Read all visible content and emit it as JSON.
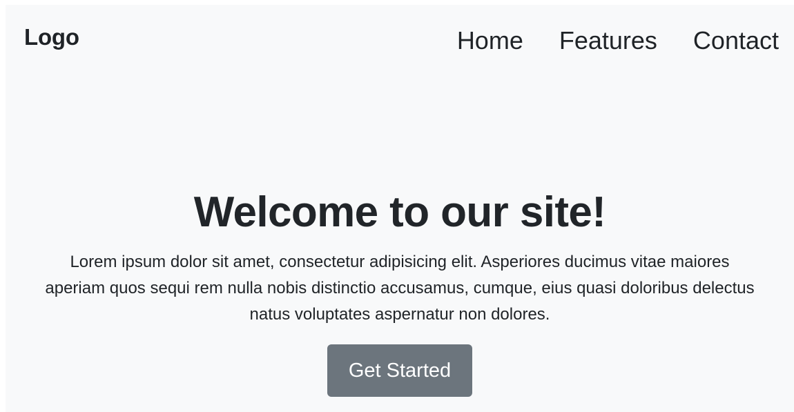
{
  "navbar": {
    "logo": "Logo",
    "links": [
      {
        "label": "Home"
      },
      {
        "label": "Features"
      },
      {
        "label": "Contact"
      }
    ]
  },
  "hero": {
    "title": "Welcome to our site!",
    "description": "Lorem ipsum dolor sit amet, consectetur adipisicing elit. Asperiores ducimus vitae maiores aperiam quos sequi rem nulla nobis distinctio accusamus, cumque, eius quasi doloribus delectus natus voluptates aspernatur non dolores.",
    "cta_label": "Get Started"
  },
  "colors": {
    "page_background": "#f8f9fa",
    "button_background": "#6c757d",
    "text": "#212529"
  }
}
